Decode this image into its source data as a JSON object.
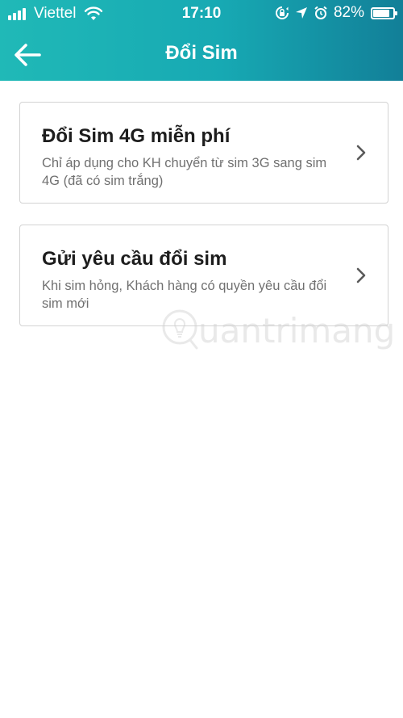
{
  "status_bar": {
    "carrier": "Viettel",
    "time": "17:10",
    "battery_percent": "82%",
    "battery_level": 0.82
  },
  "header": {
    "title": "Đổi Sim",
    "back_icon": "arrow-left-icon",
    "background_colors": [
      "#20b9b7",
      "#127f98"
    ]
  },
  "options": [
    {
      "title": "Đổi Sim 4G miễn phí",
      "description": "Chỉ áp dụng cho KH chuyển từ sim 3G sang sim 4G (đã có sim trắng)",
      "icon": "chevron-right-icon"
    },
    {
      "title": "Gửi yêu cầu đổi sim",
      "description": "Khi sim hỏng, Khách hàng có quyền yêu cầu đổi sim mới",
      "icon": "chevron-right-icon"
    }
  ],
  "watermark": {
    "text": "uantrimang"
  }
}
